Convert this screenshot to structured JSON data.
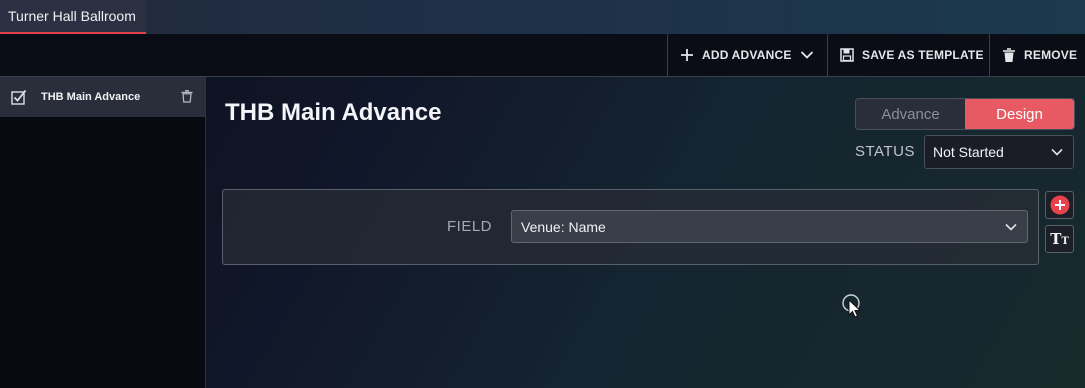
{
  "tab": {
    "label": "Turner Hall Ballroom"
  },
  "toolbar": {
    "add_advance": "ADD ADVANCE",
    "save_template": "SAVE AS TEMPLATE",
    "remove": "REMOVE",
    "icons": [
      "plus-icon",
      "chevron-down-icon",
      "save-icon",
      "trash-icon"
    ]
  },
  "sidebar": {
    "items": [
      {
        "label": "THB Main Advance",
        "checked": true
      }
    ]
  },
  "main": {
    "title": "THB Main Advance",
    "mode_tabs": [
      {
        "label": "Advance",
        "active": false
      },
      {
        "label": "Design",
        "active": true
      }
    ],
    "status": {
      "label": "STATUS",
      "value": "Not Started"
    },
    "field": {
      "label": "FIELD",
      "value": "Venue: Name"
    },
    "text_tool_label": "TT"
  },
  "colors": {
    "accent": "#e85a63",
    "toolbar_bg": "#0b0d16",
    "sidebar_selected": "#2a2e3a"
  }
}
